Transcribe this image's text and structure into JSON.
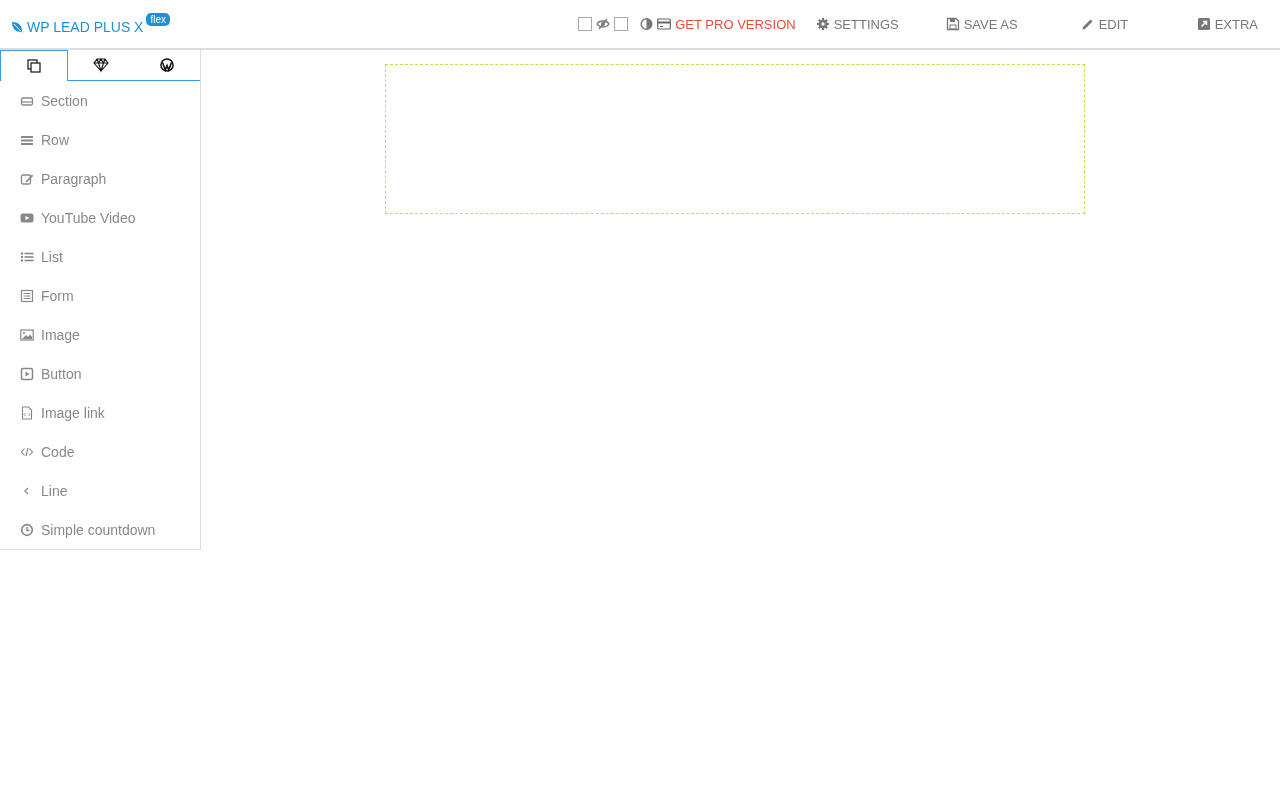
{
  "logo": {
    "title": "WP LEAD PLUS X",
    "badge": "flex"
  },
  "toolbar": {
    "toggles": [
      {
        "checked": false
      },
      {
        "checked": false
      }
    ],
    "actions": [
      {
        "label": "GET PRO VERSION",
        "kind": "promo"
      },
      {
        "label": "SETTINGS",
        "kind": "normal"
      },
      {
        "label": "SAVE AS",
        "kind": "normal"
      },
      {
        "label": "EDIT",
        "kind": "normal"
      },
      {
        "label": "EXTRA",
        "kind": "normal"
      }
    ]
  },
  "sidebar": {
    "tabs": [
      {
        "selected": true
      },
      {
        "selected": false
      },
      {
        "selected": false
      }
    ],
    "items": [
      {
        "label": "Section"
      },
      {
        "label": "Row"
      },
      {
        "label": "Paragraph"
      },
      {
        "label": "YouTube Video"
      },
      {
        "label": "List"
      },
      {
        "label": "Form"
      },
      {
        "label": "Image"
      },
      {
        "label": "Button"
      },
      {
        "label": "Image link"
      },
      {
        "label": "Code"
      },
      {
        "label": "Line"
      },
      {
        "label": "Simple countdown"
      }
    ]
  }
}
